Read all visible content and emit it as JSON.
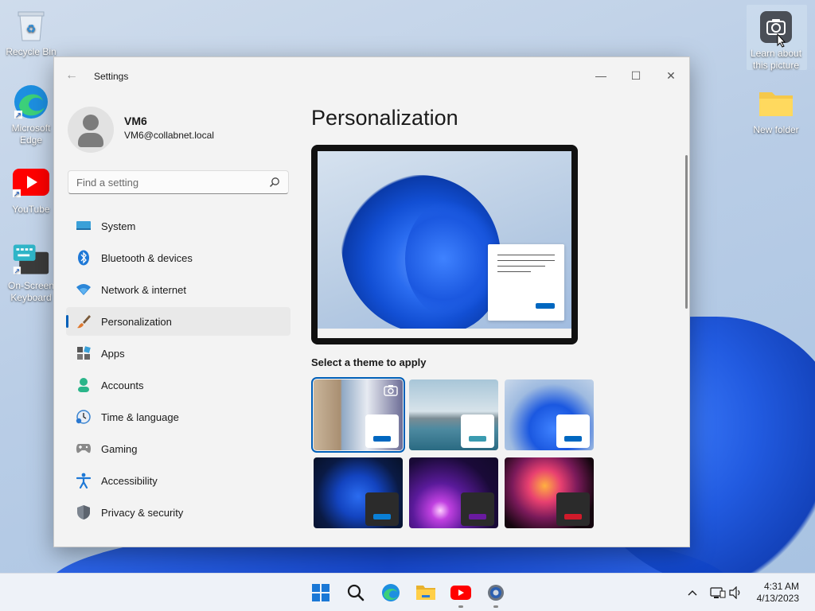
{
  "desktop": {
    "icons": [
      {
        "label": "Recycle Bin"
      },
      {
        "label": "Microsoft Edge"
      },
      {
        "label": "YouTube"
      },
      {
        "label": "On-Screen Keyboard"
      },
      {
        "label": "Learn about this picture"
      },
      {
        "label": "New folder"
      }
    ]
  },
  "window": {
    "title": "Settings",
    "controls": {
      "minimize": "—",
      "maximize": "☐",
      "close": "✕"
    }
  },
  "profile": {
    "name": "VM6",
    "email": "VM6@collabnet.local"
  },
  "search": {
    "placeholder": "Find a setting"
  },
  "nav": {
    "items": [
      {
        "label": "System"
      },
      {
        "label": "Bluetooth & devices"
      },
      {
        "label": "Network & internet"
      },
      {
        "label": "Personalization",
        "active": true
      },
      {
        "label": "Apps"
      },
      {
        "label": "Accounts"
      },
      {
        "label": "Time & language"
      },
      {
        "label": "Gaming"
      },
      {
        "label": "Accessibility"
      },
      {
        "label": "Privacy & security"
      }
    ]
  },
  "main": {
    "title": "Personalization",
    "theme_section_label": "Select a theme to apply"
  },
  "themes": [
    {
      "name": "windows-spotlight",
      "selected": true,
      "accent": "#0067c0",
      "chip": "#ffffff"
    },
    {
      "name": "glow-lake",
      "accent": "#3a9bb0",
      "chip": "#ffffff"
    },
    {
      "name": "windows-light",
      "accent": "#0067c0",
      "chip": "#ffffff"
    },
    {
      "name": "windows-dark",
      "accent": "#0a7fd6",
      "chip": "#2b2b2b"
    },
    {
      "name": "glow-purple",
      "accent": "#6a1aa0",
      "chip": "#2b2b2b"
    },
    {
      "name": "captured-motion",
      "accent": "#d01a2a",
      "chip": "#2b2b2b"
    }
  ],
  "taskbar": {
    "time": "4:31 AM",
    "date": "4/13/2023"
  },
  "colors": {
    "accent": "#005fb8",
    "window_bg": "#f3f3f3"
  }
}
